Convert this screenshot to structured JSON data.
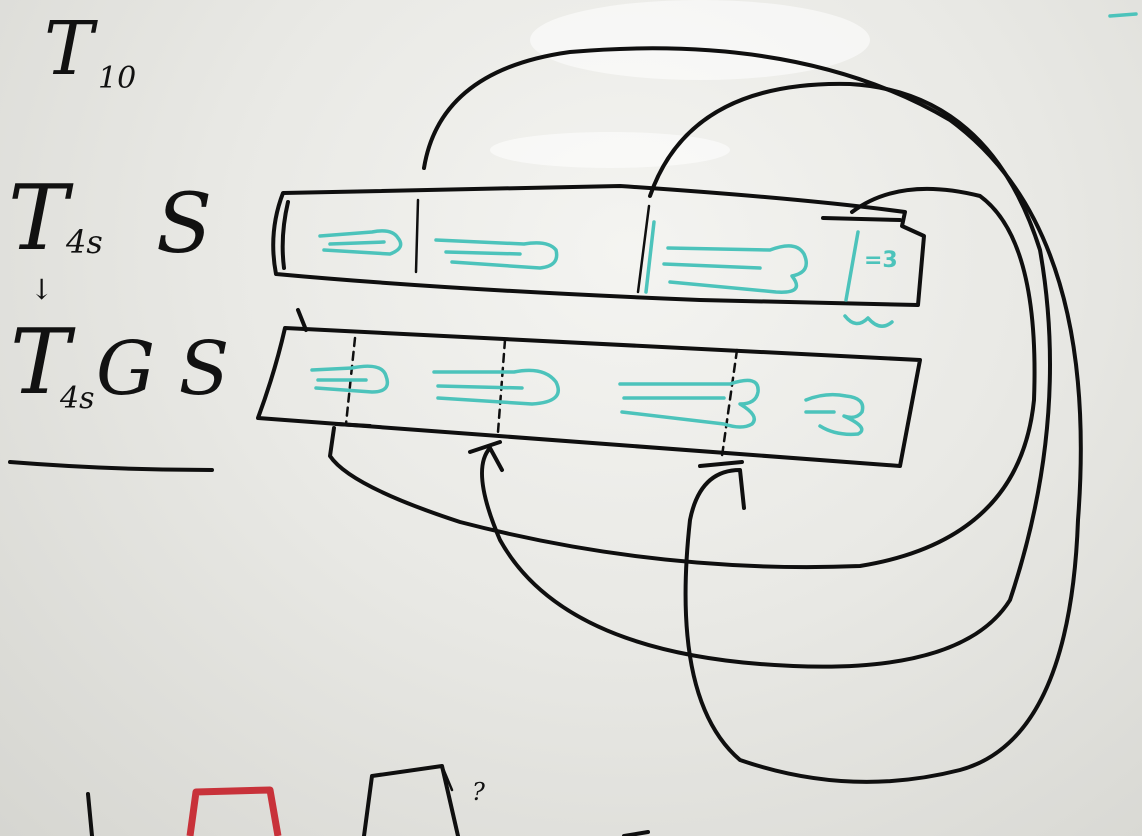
{
  "board": {
    "label_top": {
      "main": "T",
      "sub": "10"
    },
    "row1": {
      "main": "T",
      "sub": "4s",
      "suffix": "S",
      "under": "↓"
    },
    "row2": {
      "main": "T",
      "sub": "4s",
      "suffix": "G S"
    },
    "question_mark": "?",
    "strip_cell_mark": "=3"
  },
  "colors": {
    "ink": "#0f0f0f",
    "teal_marker": "#4cc3bb",
    "red_marker": "#c8323a",
    "board": "#eeeeea"
  }
}
